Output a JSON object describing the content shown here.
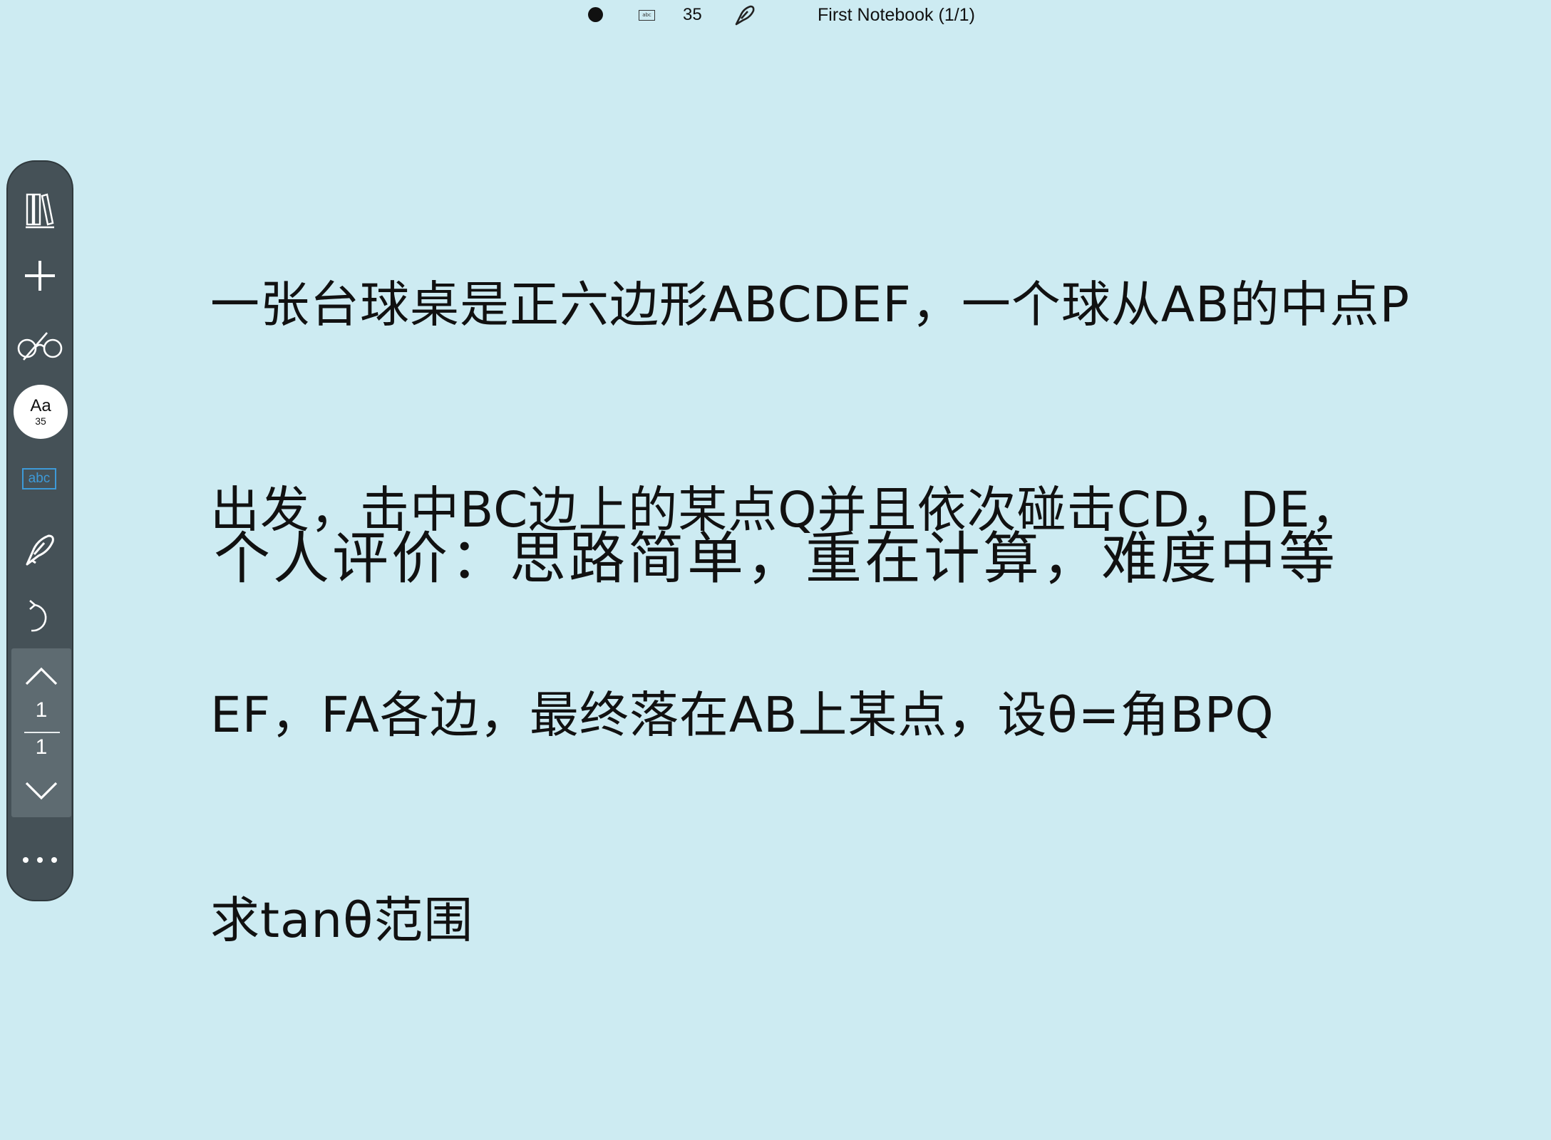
{
  "status_bar": {
    "pen_size": "35",
    "notebook_title": "First Notebook (1/1)",
    "abc_label": "abc"
  },
  "toolbar": {
    "font_button": {
      "label": "Aa",
      "size": "35"
    },
    "abc_label": "abc",
    "page_current": "1",
    "page_total": "1",
    "icons": [
      "library-icon",
      "add-icon",
      "glasses-icon",
      "font-size-icon",
      "text-mode-icon",
      "pen-icon",
      "undo-icon",
      "page-up-icon",
      "page-down-icon",
      "more-icon"
    ]
  },
  "content": {
    "question_lines": [
      "一张台球桌是正六边形ABCDEF，一个球从AB的中点P",
      "出发，击中BC边上的某点Q并且依次碰击CD，DE，",
      "EF，FA各边，最终落在AB上某点，设θ=角BPQ",
      "求tanθ范围"
    ],
    "evaluation": "个人评价：思路简单，重在计算，难度中等"
  },
  "colors": {
    "background": "#cdebf2",
    "toolbar": "#455157",
    "accent": "#3d9ad8"
  }
}
